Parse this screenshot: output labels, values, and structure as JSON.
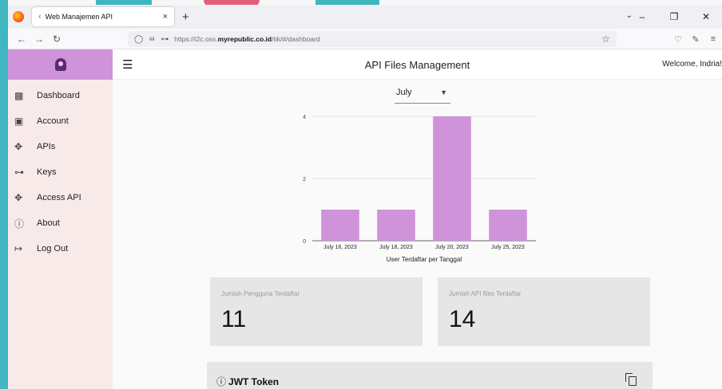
{
  "browser": {
    "tab_title": "Web Manajemen API",
    "tab_favicon": "flutter-icon",
    "tab_close": "×",
    "new_tab": "+",
    "url_prefix": "https://i2c.oss.",
    "url_domain": "myrepublic.co.id",
    "url_path": "/tik/#/dashboard"
  },
  "app": {
    "title": "API Files Management",
    "welcome": "Welcome, Indria!",
    "accent_color": "#cf93d9",
    "sidebar_bg": "#f9eaea"
  },
  "sidebar": {
    "items": [
      {
        "label": "Dashboard",
        "icon": "dashboard-icon"
      },
      {
        "label": "Account",
        "icon": "account-icon"
      },
      {
        "label": "APIs",
        "icon": "api-icon"
      },
      {
        "label": "Keys",
        "icon": "key-icon"
      },
      {
        "label": "Access API",
        "icon": "api-icon"
      },
      {
        "label": "About",
        "icon": "info-icon"
      },
      {
        "label": "Log Out",
        "icon": "logout-icon"
      }
    ]
  },
  "filter": {
    "month": "July"
  },
  "chart_data": {
    "type": "bar",
    "categories": [
      "July 16, 2023",
      "July 18, 2023",
      "July 20, 2023",
      "July 25, 2023"
    ],
    "values": [
      1,
      1,
      4,
      1
    ],
    "xlabel": "User Terdaftar per Tanggal",
    "ylabel": "",
    "ylim": [
      0,
      4
    ],
    "yticks": [
      0,
      2,
      4
    ],
    "bar_color": "#cf93d9",
    "grid": true
  },
  "stats": {
    "users_label": "Jumlah Pengguna Terdaftar",
    "users_value": "11",
    "apis_label": "Jumlah API files Terdaftar",
    "apis_value": "14"
  },
  "jwt": {
    "title": "JWT Token",
    "info_glyph": "ⓘ"
  }
}
